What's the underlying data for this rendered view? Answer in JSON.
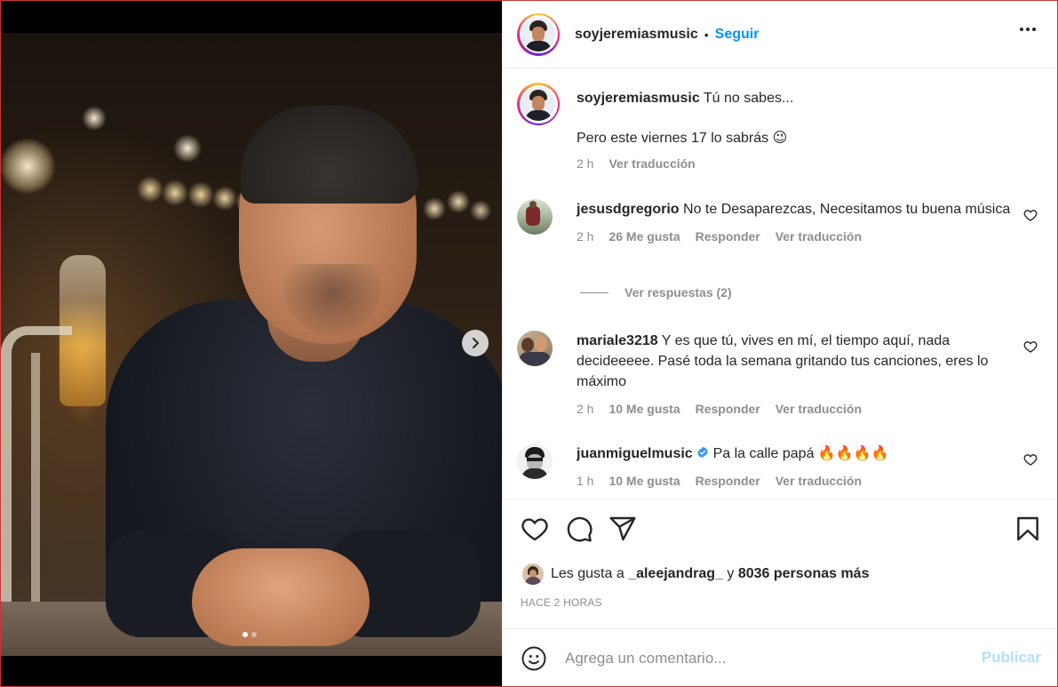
{
  "post": {
    "author": "soyjeremiasmusic",
    "separator": "•",
    "follow_label": "Seguir",
    "more_icon": "more-horizontal-icon"
  },
  "caption": {
    "user": "soyjeremiasmusic",
    "line1": "Tú no sabes...",
    "line2": "Pero este viernes 17 lo sabrás 😉",
    "time": "2 h",
    "translate": "Ver traducción"
  },
  "comments": [
    {
      "user": "jesusdgregorio",
      "text": "No te Desaparezcas, Necesitamos tu buena música",
      "time": "2 h",
      "likes": "26 Me gusta",
      "reply": "Responder",
      "translate": "Ver traducción"
    },
    {
      "user": "mariale3218",
      "text": "Y es que tú, vives en mí, el tiempo aquí, nada decideeeee. Pasé toda la semana gritando tus canciones, eres lo máximo",
      "time": "2 h",
      "likes": "10 Me gusta",
      "reply": "Responder",
      "translate": "Ver traducción"
    },
    {
      "user": "juanmiguelmusic",
      "verified": true,
      "text": "Pa la calle papá 🔥🔥🔥🔥",
      "time": "1 h",
      "likes": "10 Me gusta",
      "reply": "Responder",
      "translate": "Ver traducción"
    }
  ],
  "view_replies": "Ver respuestas (2)",
  "likes_line": {
    "prefix": "Les gusta a",
    "user": "_aleejandrag_",
    "conj": "y",
    "others": "8036 personas más"
  },
  "timestamp": "HACE 2 HORAS",
  "add_comment": {
    "placeholder": "Agrega un comentario...",
    "publish_label": "Publicar"
  },
  "carousel": {
    "current": 1,
    "total": 2
  },
  "colors": {
    "accent": "#0095f6",
    "publish_disabled": "#b2dffc",
    "muted": "#8e8e8e",
    "verified": "#3897f0"
  }
}
